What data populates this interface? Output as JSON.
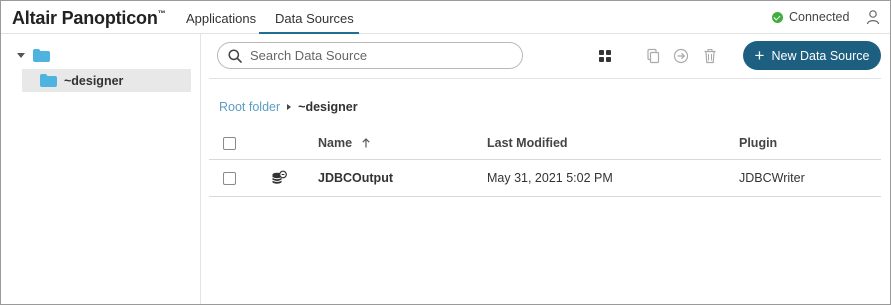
{
  "header": {
    "brand": "Altair Panopticon",
    "brand_mark": "™",
    "tabs": [
      {
        "label": "Applications",
        "active": false
      },
      {
        "label": "Data Sources",
        "active": true
      }
    ],
    "status": {
      "label": "Connected",
      "color": "#3fae3f"
    },
    "user_icon": "user-icon"
  },
  "sidebar": {
    "root": {
      "icon": "folder-icon",
      "expanded": true
    },
    "children": [
      {
        "label": "~designer",
        "icon": "folder-icon",
        "selected": true
      }
    ]
  },
  "toolbar": {
    "search_placeholder": "Search Data Source",
    "search_value": "",
    "icons": [
      "grid-view-icon",
      "copy-icon",
      "move-icon",
      "delete-icon"
    ],
    "new_button_label": "New Data Source",
    "accent_color": "#1d5f80"
  },
  "breadcrumb": {
    "root": "Root folder",
    "current": "~designer"
  },
  "table": {
    "columns": {
      "name": "Name",
      "last_modified": "Last Modified",
      "plugin": "Plugin"
    },
    "sort": {
      "column": "Name",
      "direction": "ascending"
    },
    "rows": [
      {
        "icon": "database-output-icon",
        "name": "JDBCOutput",
        "last_modified": "May 31, 2021 5:02 PM",
        "plugin": "JDBCWriter",
        "checked": false
      }
    ]
  }
}
